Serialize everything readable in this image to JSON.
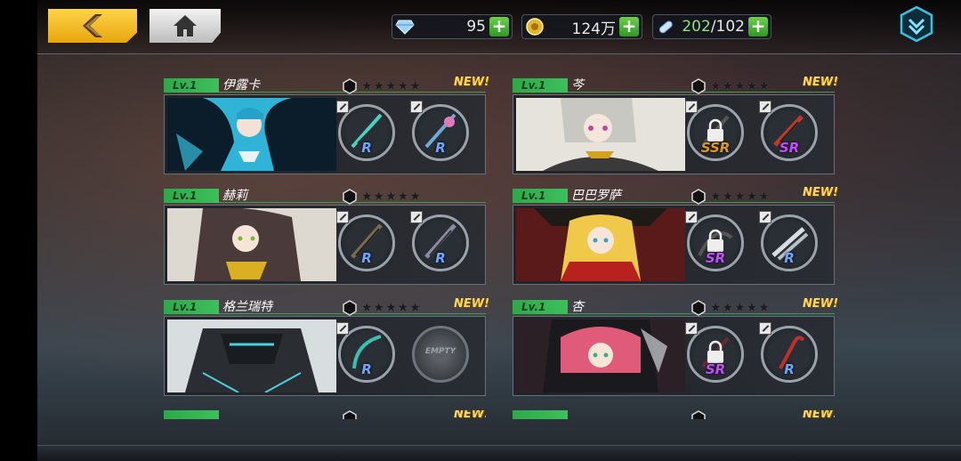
{
  "header": {
    "resources": {
      "gems": "95",
      "gold": "124万",
      "stamina_current": "202",
      "stamina_max": "/102"
    },
    "plus_label": "+"
  },
  "characters": [
    {
      "level": "Lv.1",
      "name": "伊露卡",
      "new": "NEW!",
      "stars": "★★★★★",
      "slot1": {
        "rarity": "R",
        "locked": false
      },
      "slot2": {
        "rarity": "R",
        "locked": false
      }
    },
    {
      "level": "Lv.1",
      "name": "芩",
      "new": "NEW!",
      "stars": "★★★★★",
      "slot1": {
        "rarity": "SSR",
        "locked": true
      },
      "slot2": {
        "rarity": "SR",
        "locked": false
      }
    },
    {
      "level": "Lv.1",
      "name": "赫莉",
      "new": "",
      "stars": "★★★★★",
      "slot1": {
        "rarity": "R",
        "locked": false
      },
      "slot2": {
        "rarity": "R",
        "locked": false
      }
    },
    {
      "level": "Lv.1",
      "name": "巴巴罗萨",
      "new": "NEW!",
      "stars": "★★★★★",
      "slot1": {
        "rarity": "SR",
        "locked": true
      },
      "slot2": {
        "rarity": "R",
        "locked": false
      }
    },
    {
      "level": "Lv.1",
      "name": "格兰瑞特",
      "new": "NEW!",
      "stars": "★★★★★",
      "slot1": {
        "rarity": "R",
        "locked": false
      },
      "slot2": {
        "rarity": "EMPTY",
        "locked": false
      }
    },
    {
      "level": "Lv.1",
      "name": "杏",
      "new": "NEW!",
      "stars": "★★★★★",
      "slot1": {
        "rarity": "SR",
        "locked": true
      },
      "slot2": {
        "rarity": "R",
        "locked": false
      }
    }
  ],
  "partial_rows": [
    {
      "new": "NEW!"
    },
    {
      "new": "NEW!"
    }
  ],
  "colors": {
    "accent_yellow": "#f5b91e",
    "level_green": "#3cc05a",
    "rarity_r": "#6aa5ff",
    "rarity_sr": "#c44bff",
    "rarity_ssr": "#d99a2a"
  },
  "icons": [
    "back-arrow-icon",
    "home-icon",
    "gem-icon",
    "gold-coin-icon",
    "stamina-pill-icon",
    "plus-icon",
    "menu-chevron-icon",
    "hexagon-icon",
    "star-icon",
    "lock-icon",
    "edit-badge-icon",
    "weapon-icon"
  ]
}
